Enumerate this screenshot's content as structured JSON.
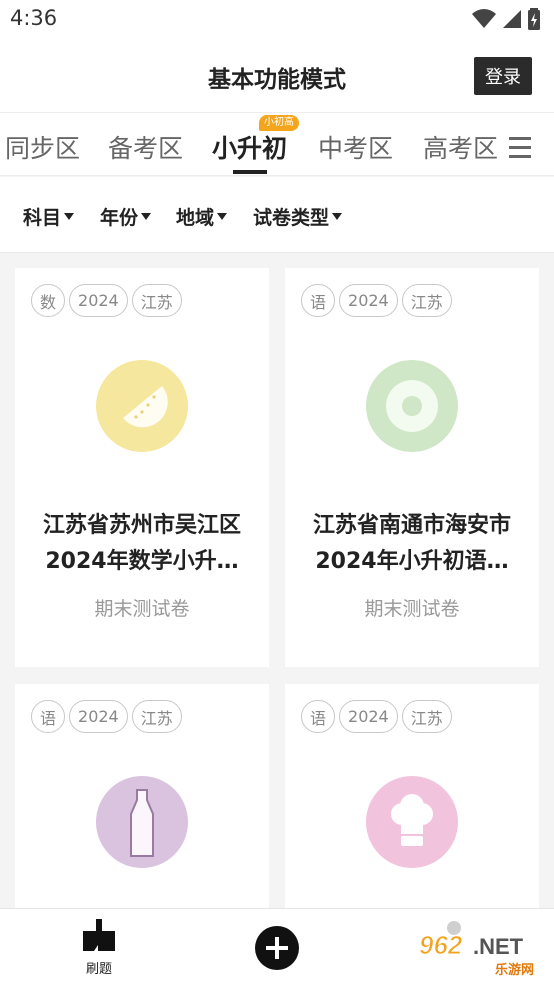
{
  "status_bar": {
    "time": "4:36"
  },
  "header": {
    "title": "基本功能模式",
    "login_label": "登录"
  },
  "tabs": {
    "items": [
      {
        "label": "同步区"
      },
      {
        "label": "备考区"
      },
      {
        "label": "小升初",
        "badge": "小初高"
      },
      {
        "label": "中考区"
      },
      {
        "label": "高考区"
      }
    ],
    "active": "小升初"
  },
  "filters": [
    {
      "label": "科目"
    },
    {
      "label": "年份"
    },
    {
      "label": "地域"
    },
    {
      "label": "试卷类型"
    }
  ],
  "cards": [
    {
      "tags": [
        "数",
        "2024",
        "江苏"
      ],
      "title_line1": "江苏省苏州市吴江区",
      "title_line2": "2024年数学小升…",
      "subtitle": "期末测试卷",
      "cover_icon": "melon-slice-icon",
      "cover_color": "#f5e79e"
    },
    {
      "tags": [
        "语",
        "2024",
        "江苏"
      ],
      "title_line1": "江苏省南通市海安市",
      "title_line2": "2024年小升初语…",
      "subtitle": "期末测试卷",
      "cover_icon": "donut-icon",
      "cover_color": "#cfe7c6"
    },
    {
      "tags": [
        "语",
        "2024",
        "江苏"
      ],
      "title_line1": "",
      "title_line2": "",
      "subtitle": "",
      "cover_icon": "bottle-icon",
      "cover_color": "#d9c3df"
    },
    {
      "tags": [
        "语",
        "2024",
        "江苏"
      ],
      "title_line1": "",
      "title_line2": "",
      "subtitle": "",
      "cover_icon": "chef-hat-icon",
      "cover_color": "#f2c3dd"
    }
  ],
  "bottom_nav": {
    "practice_label": "刷题"
  },
  "watermark": {
    "text_main": "962.NET",
    "text_sub": "乐游网"
  }
}
